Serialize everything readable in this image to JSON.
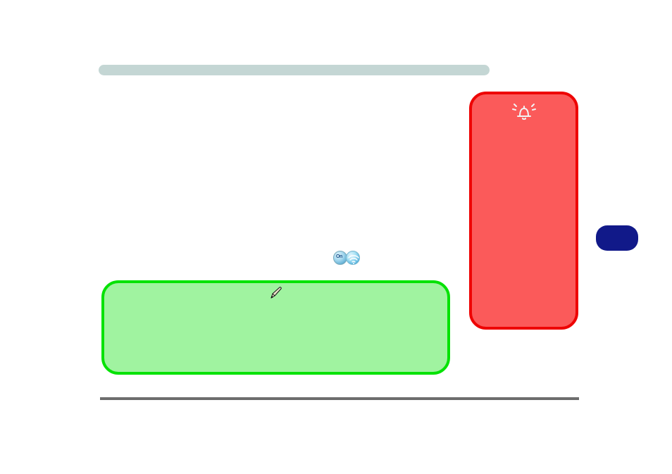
{
  "top_bar": {
    "color": "#c4d6d4"
  },
  "red_panel": {
    "bg": "#fb5a5a",
    "border": "#ee0404",
    "icon": "alarm-bell"
  },
  "badges": {
    "on_label": "On",
    "wifi_label": "wifi"
  },
  "green_panel": {
    "bg": "#a0f3a0",
    "border": "#05e205",
    "icon": "pen"
  },
  "bottom_line": {
    "color": "#6d6d6d"
  },
  "side_pill": {
    "color": "#111989"
  }
}
